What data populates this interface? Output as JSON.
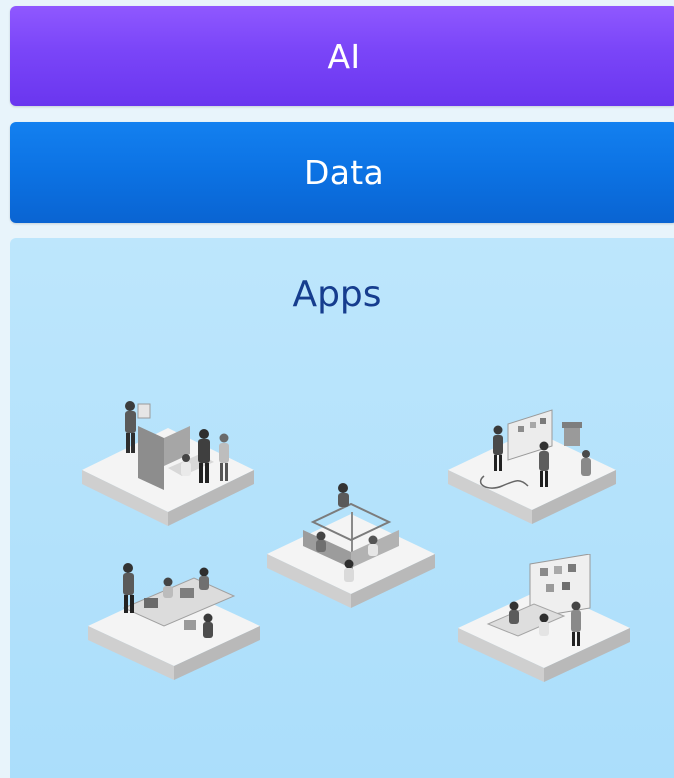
{
  "layers": {
    "ai": {
      "label": "AI"
    },
    "data": {
      "label": "Data"
    },
    "apps": {
      "label": "Apps"
    }
  },
  "colors": {
    "ai": "#7a45f8",
    "data": "#0c72e3",
    "apps_bg": "#b2e1fb",
    "apps_title": "#163d8e"
  },
  "illustrations": [
    "office-cubicle-scene-icon",
    "open-workspace-scene-icon",
    "brainstorm-whiteboard-scene-icon",
    "team-desk-scene-icon",
    "planning-board-scene-icon"
  ]
}
